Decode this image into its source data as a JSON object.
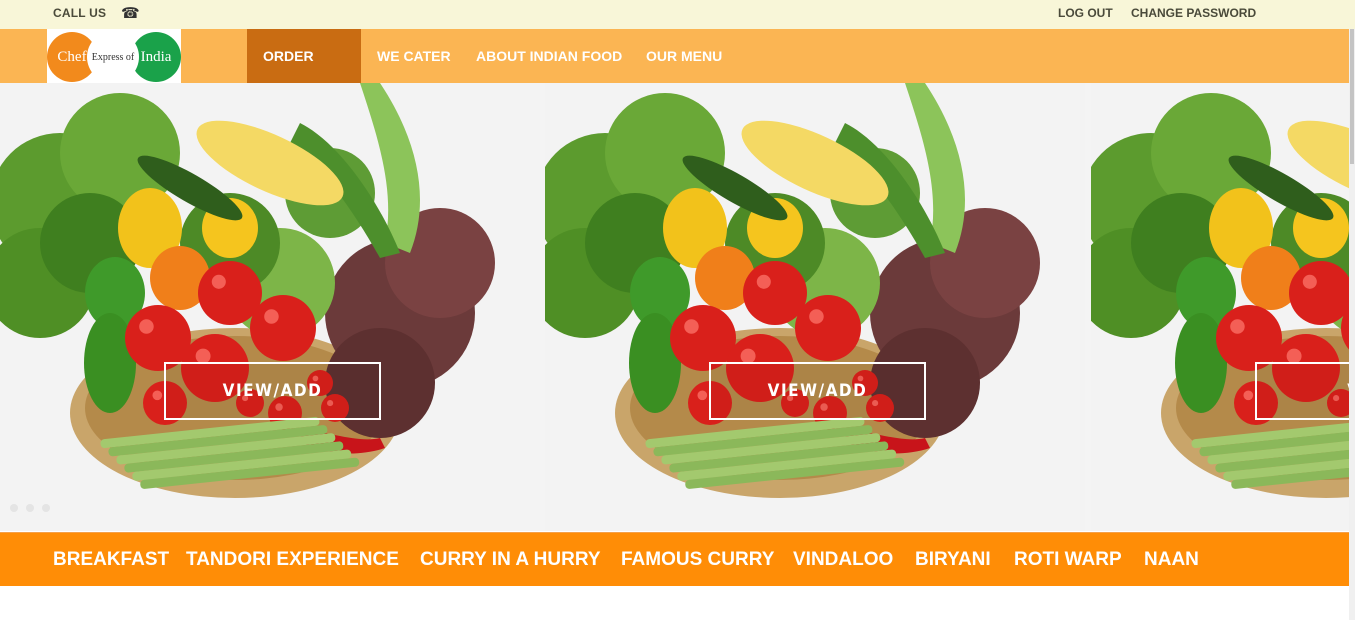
{
  "topbar": {
    "call_us": "CALL US",
    "phone_icon": "phone-icon",
    "logout": "LOG OUT",
    "change_password": "CHANGE PASSWORD"
  },
  "logo": {
    "left_word": "Chef",
    "middle_word": "Express of",
    "right_word": "India"
  },
  "nav": {
    "items": [
      {
        "label": "ORDER NOW",
        "active": true
      },
      {
        "label": "WE CATER",
        "active": false
      },
      {
        "label": "ABOUT INDIAN FOOD",
        "active": false
      },
      {
        "label": "OUR MENU",
        "active": false
      }
    ]
  },
  "slider": {
    "slides": [
      {
        "button": "VIEW/ADD"
      },
      {
        "button": "VIEW/ADD"
      },
      {
        "button": "VIE"
      }
    ]
  },
  "categories": [
    "BREAKFAST",
    "TANDORI EXPERIENCE",
    "CURRY IN A HURRY",
    "FAMOUS CURRY",
    "VINDALOO",
    "BIRYANI",
    "ROTI WARP",
    "NAAN"
  ],
  "colors": {
    "topbar_bg": "#f8f6d8",
    "nav_bg": "#fbb553",
    "nav_active": "#c96c12",
    "category_bg": "#ff8d06"
  }
}
